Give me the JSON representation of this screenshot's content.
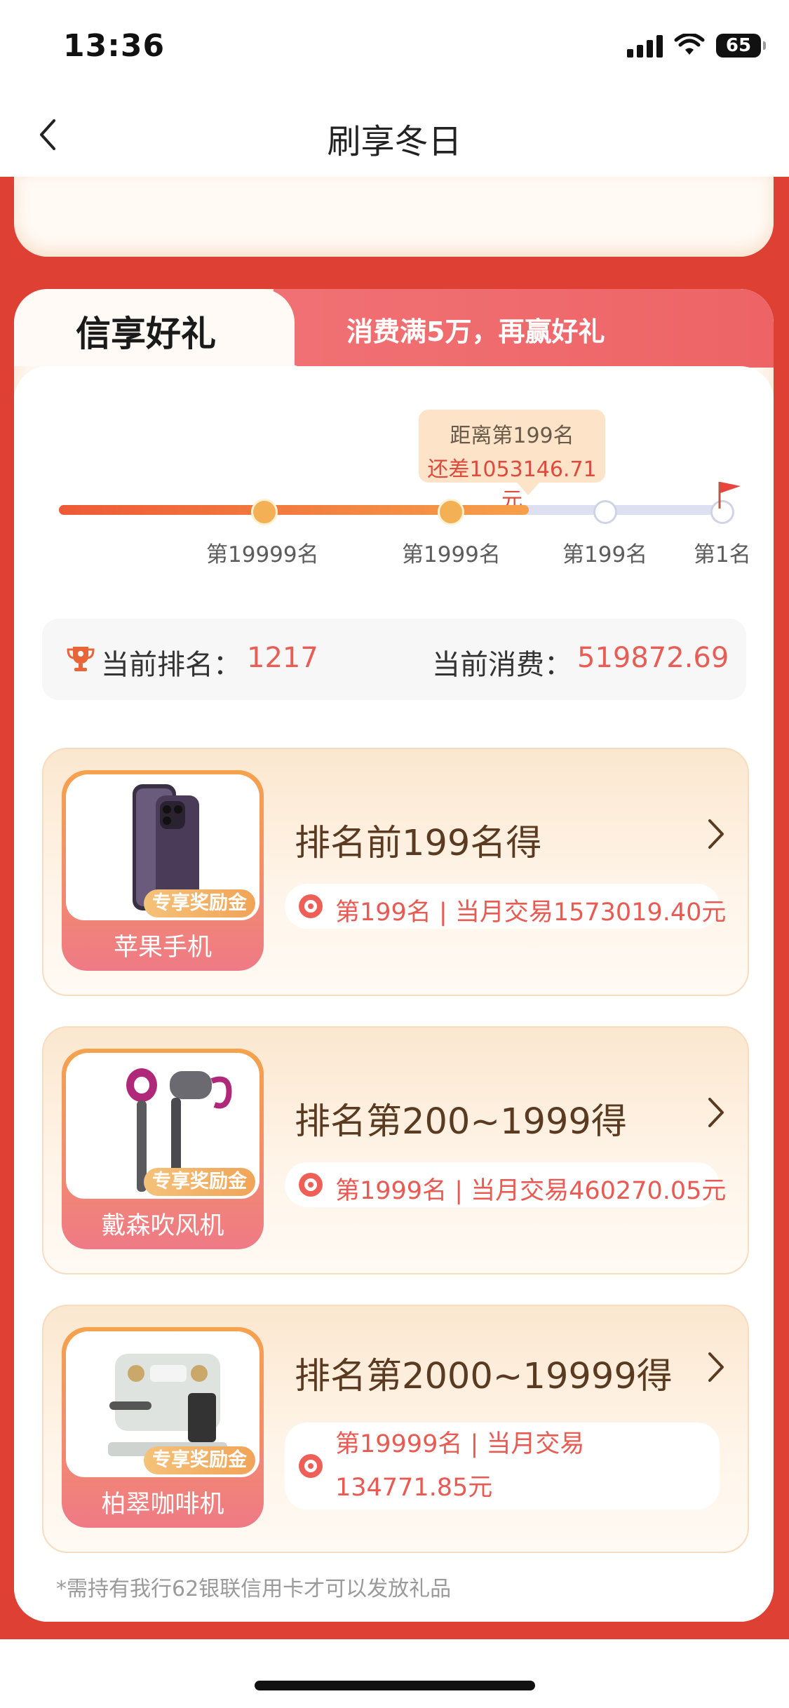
{
  "status_bar": {
    "time": "13:36",
    "battery": "65"
  },
  "nav": {
    "title": "刷享冬日"
  },
  "tabs": {
    "active": "信享好礼",
    "secondary": "消费满5万，再赢好礼"
  },
  "progress": {
    "bubble_line1": "距离第199名",
    "bubble_line2": "还差1053146.71元",
    "milestones": [
      "第19999名",
      "第1999名",
      "第199名",
      "第1名"
    ],
    "filled_fraction": 0.71
  },
  "stats": {
    "rank_label": "当前排名：",
    "rank_value": "1217",
    "spend_label": "当前消费：",
    "spend_value": "519872.69"
  },
  "prizes": [
    {
      "title": "排名前199名得",
      "product": "苹果手机",
      "badge": "专享奖励金",
      "info": "第199名 | 当月交易1573019.40元",
      "image": "iphone-image"
    },
    {
      "title": "排名第200~1999得",
      "product": "戴森吹风机",
      "badge": "专享奖励金",
      "info": "第1999名 | 当月交易460270.05元",
      "image": "hairdryer-image"
    },
    {
      "title": "排名第2000~19999得",
      "product": "柏翠咖啡机",
      "badge": "专享奖励金",
      "info": "第19999名 | 当月交易134771.85元",
      "image": "coffee-machine-image"
    }
  ],
  "note": "*需持有我行62银联信用卡才可以发放礼品",
  "colors": {
    "page_red": "#df4034",
    "accent_red": "#e85d55",
    "progress_orange": "#ee5a36",
    "tab_pink": "#ee6466"
  }
}
